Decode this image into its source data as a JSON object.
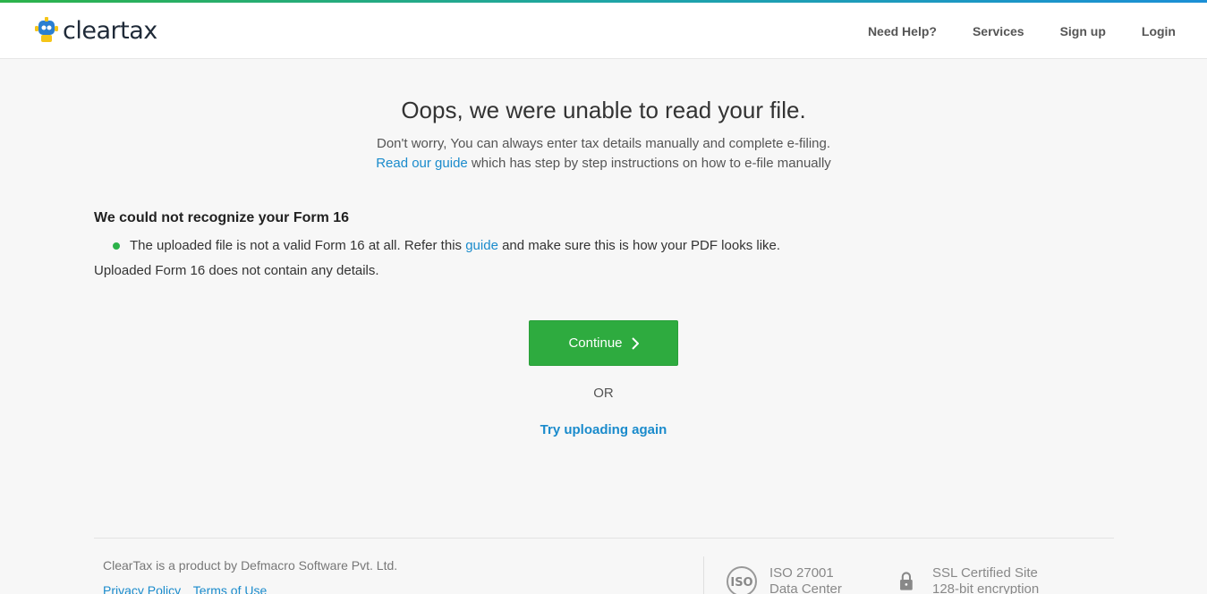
{
  "header": {
    "logo_text": "cleartax",
    "nav": [
      "Need Help?",
      "Services",
      "Sign up",
      "Login"
    ]
  },
  "main": {
    "title": "Oops, we were unable to read your file.",
    "subtitle_line1": "Don't worry, You can always enter tax details manually and complete e-filing.",
    "guide_link": "Read our guide",
    "subtitle_line2_rest": " which has step by step instructions on how to e-file manually"
  },
  "error": {
    "heading": "We could not recognize your Form 16",
    "bullet_before": "The uploaded file is not a valid Form 16 at all. Refer this ",
    "bullet_link": "guide",
    "bullet_after": " and make sure this is how your PDF looks like.",
    "detail": "Uploaded Form 16 does not contain any details."
  },
  "actions": {
    "continue_label": "Continue",
    "or_label": "OR",
    "retry_label": "Try uploading again"
  },
  "footer": {
    "company_text": "ClearTax is a product by Defmacro Software Pvt. Ltd.",
    "privacy_link": "Privacy Policy",
    "terms_link": "Terms of Use",
    "iso_title": "ISO 27001",
    "iso_sub": "Data Center",
    "ssl_title": "SSL Certified Site",
    "ssl_sub": "128-bit encryption"
  },
  "colors": {
    "accent_green": "#2eab3f",
    "link_blue": "#1a8bcc",
    "background": "#f7f7f7"
  },
  "icons": [
    "cleartax-logo-icon",
    "chevron-right-icon",
    "bullet-dot-icon",
    "iso-icon",
    "lock-icon"
  ]
}
